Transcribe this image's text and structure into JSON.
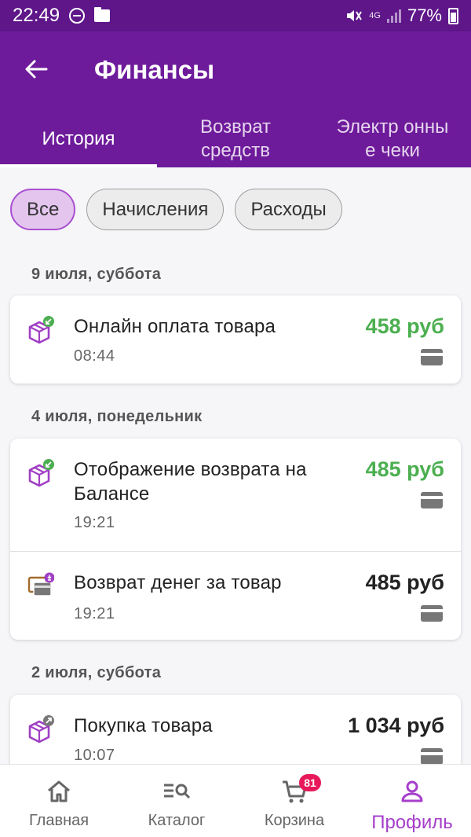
{
  "status_bar": {
    "time": "22:49",
    "network": "4G",
    "battery": "77%"
  },
  "header": {
    "title": "Финансы",
    "tabs": [
      {
        "label": "История",
        "active": true
      },
      {
        "label": "Возврат средств",
        "active": false
      },
      {
        "label": "Электр онные чеки",
        "active": false
      }
    ]
  },
  "filters": [
    {
      "label": "Все",
      "active": true
    },
    {
      "label": "Начисления",
      "active": false
    },
    {
      "label": "Расходы",
      "active": false
    }
  ],
  "groups": [
    {
      "date": "9 июля, суббота",
      "items": [
        {
          "title": "Онлайн оплата товара",
          "time": "08:44",
          "amount": "458 руб",
          "type": "credit",
          "icon": "box-incoming-icon"
        }
      ]
    },
    {
      "date": "4 июля, понедельник",
      "items": [
        {
          "title": "Отображение возврата на Балансе",
          "time": "19:21",
          "amount": "485 руб",
          "type": "credit",
          "icon": "box-incoming-icon"
        },
        {
          "title": "Возврат денег за товар",
          "time": "19:21",
          "amount": "485 руб",
          "type": "neutral",
          "icon": "wallet-refund-icon"
        }
      ]
    },
    {
      "date": "2 июля, суббота",
      "items": [
        {
          "title": "Покупка товара",
          "time": "10:07",
          "amount": "1 034 руб",
          "type": "debit",
          "icon": "box-outgoing-icon"
        }
      ]
    }
  ],
  "bottom_nav": [
    {
      "label": "Главная",
      "icon": "home-icon",
      "active": false
    },
    {
      "label": "Каталог",
      "icon": "catalog-search-icon",
      "active": false
    },
    {
      "label": "Корзина",
      "icon": "cart-icon",
      "active": false,
      "badge": "81"
    },
    {
      "label": "Профиль",
      "icon": "profile-icon",
      "active": true
    }
  ],
  "colors": {
    "primary": "#6e1b9b",
    "status_bar": "#5e1689",
    "credit_green": "#4caf50",
    "accent": "#a63fcb",
    "badge": "#e7195b"
  }
}
